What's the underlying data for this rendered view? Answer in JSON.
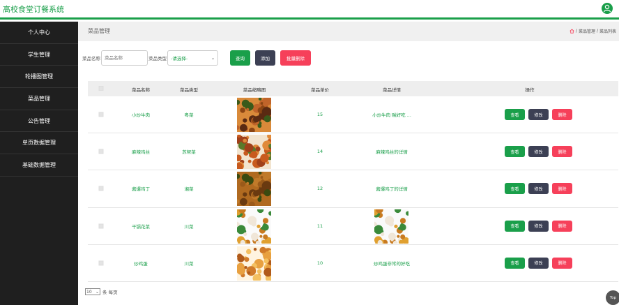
{
  "header": {
    "title": "高校食堂订餐系统"
  },
  "sidebar": {
    "items": [
      {
        "label": "个人中心"
      },
      {
        "label": "学生管理"
      },
      {
        "label": "轮播图管理"
      },
      {
        "label": "菜品管理"
      },
      {
        "label": "公告管理"
      },
      {
        "label": "单页数据管理"
      },
      {
        "label": "基础数据管理"
      }
    ]
  },
  "page": {
    "title": "菜品管理",
    "breadcrumb": [
      "菜品管理",
      "菜品列表"
    ]
  },
  "search": {
    "name_label": "菜品名称",
    "name_placeholder": "菜品名称",
    "type_label": "菜品类型",
    "type_value": "-请选择-",
    "query": "查询",
    "add": "添加",
    "batch_delete": "批量删除"
  },
  "table": {
    "headers": [
      "菜品名称",
      "菜品类型",
      "菜品缩略图",
      "菜品单价",
      "菜品详情",
      "操作"
    ],
    "rows": [
      {
        "name": "小炒牛肉",
        "type": "粤菜",
        "price": "15",
        "detail": "小炒牛肉 贼好吃 ...",
        "detail_image": false,
        "thumb_style": "beef"
      },
      {
        "name": "麻辣鸡丝",
        "type": "苏帮菜",
        "price": "14",
        "detail": "麻辣鸡丝的详情",
        "detail_image": false,
        "thumb_style": "chicken"
      },
      {
        "name": "酱爆鸡丁",
        "type": "湘菜",
        "price": "12",
        "detail": "酱爆鸡丁的详情",
        "detail_image": false,
        "thumb_style": "dice"
      },
      {
        "name": "干锅花菜",
        "type": "川菜",
        "price": "11",
        "detail": "",
        "detail_image": true,
        "thumb_style": "cauliflower"
      },
      {
        "name": "炒鸡蛋",
        "type": "川菜",
        "price": "10",
        "detail": "炒鸡蛋非常的好吃",
        "detail_image": false,
        "thumb_style": "egg"
      }
    ],
    "actions": {
      "view": "查看",
      "edit": "修改",
      "delete": "删除"
    }
  },
  "pager": {
    "page_size": "10",
    "suffix": "条 每页"
  },
  "top_button": "Top",
  "colors": {
    "accent": "#1a9f4a",
    "dark": "#3c4054",
    "danger": "#f6405a",
    "sidebar": "#1f1f1f"
  }
}
